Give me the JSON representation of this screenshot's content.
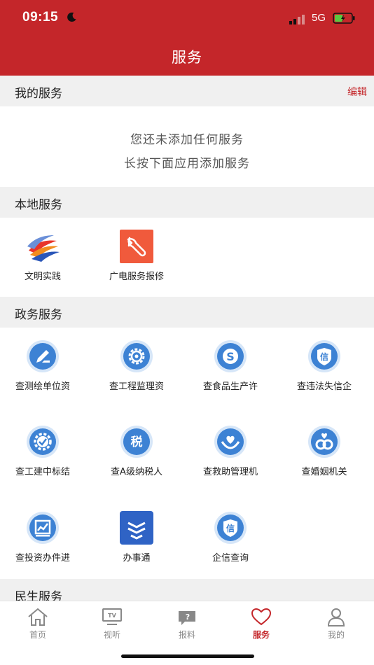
{
  "status_bar": {
    "time": "09:15",
    "network": "5G"
  },
  "header": {
    "title": "服务"
  },
  "my_services": {
    "title": "我的服务",
    "edit_label": "编辑",
    "empty_line1": "您还未添加任何服务",
    "empty_line2": "长按下面应用添加服务"
  },
  "local_services": {
    "title": "本地服务",
    "items": [
      {
        "label": "文明实践",
        "icon": "civilization-practice-logo"
      },
      {
        "label": "广电服务报修",
        "icon": "wrench-repair-icon"
      }
    ]
  },
  "gov_services": {
    "title": "政务服务",
    "items": [
      {
        "label": "查测绘单位资",
        "icon": "survey-pen-icon"
      },
      {
        "label": "查工程监理资",
        "icon": "gear-icon"
      },
      {
        "label": "查食品生产许",
        "icon": "food-s-icon"
      },
      {
        "label": "查违法失信企",
        "icon": "credit-shield-icon"
      },
      {
        "label": "查工建中标结",
        "icon": "checked-gear-icon"
      },
      {
        "label": "查A级纳税人",
        "icon": "tax-icon"
      },
      {
        "label": "查救助管理机",
        "icon": "heart-hands-icon"
      },
      {
        "label": "查婚姻机关",
        "icon": "rings-icon"
      },
      {
        "label": "查投资办件进",
        "icon": "investment-chart-icon"
      },
      {
        "label": "办事通",
        "icon": "banshitong-logo"
      },
      {
        "label": "企信查询",
        "icon": "enterprise-credit-icon"
      }
    ]
  },
  "people_services": {
    "title": "民生服务"
  },
  "tabbar": {
    "tabs": [
      {
        "label": "首页",
        "icon": "home-icon"
      },
      {
        "label": "视听",
        "icon": "tv-icon"
      },
      {
        "label": "报料",
        "icon": "report-icon"
      },
      {
        "label": "服务",
        "icon": "heart-icon",
        "active": true
      },
      {
        "label": "我的",
        "icon": "person-icon"
      }
    ]
  },
  "colors": {
    "brand": "#c4262a",
    "icon_blue": "#3d82d4",
    "section_bg": "#f0f0f0"
  }
}
